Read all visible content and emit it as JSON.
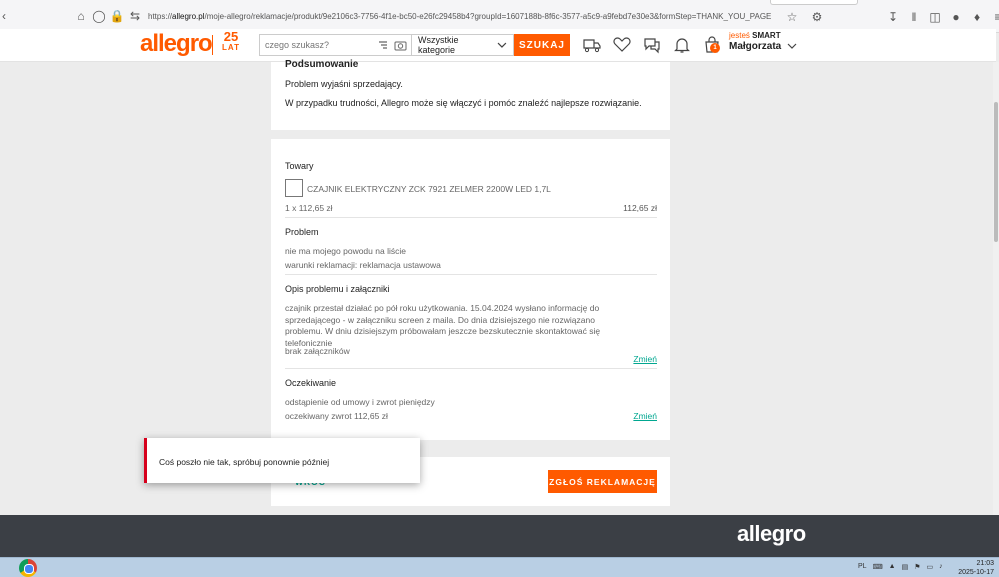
{
  "browser": {
    "url_prefix": "https://",
    "url_domain": "allegro.pl",
    "url_path": "/moje-allegro/reklamacje/produkt/9e2106c3-7756-4f1e-bc50-e26fc29458b4?groupId=1607188b-8f6c-3577-a5c9-a9febd7e30e3&formStep=THANK_YOU_PAGE"
  },
  "header": {
    "logo": "allegro",
    "logo_25": "25",
    "logo_lat": "LAT",
    "search_placeholder": "czego szukasz?",
    "category": "Wszystkie kategorie",
    "search_button": "SZUKAJ",
    "smart_prefix": "jesteś",
    "smart_label": "SMART",
    "user_name": "Małgorzata",
    "cart_count": "1"
  },
  "summary": {
    "title": "Podsumowanie",
    "line1": "Problem wyjaśni sprzedający.",
    "line2": "W przypadku trudności, Allegro może się włączyć i pomóc znaleźć najlepsze rozwiązanie."
  },
  "details": {
    "goods_label": "Towary",
    "product_name": "CZAJNIK ELEKTRYCZNY ZCK 7921 ZELMER 2200W LED 1,7L",
    "quantity_price": "1 x 112,65 zł",
    "total": "112,65 zł",
    "problem_label": "Problem",
    "problem_reason": "nie ma mojego powodu na liście",
    "problem_terms": "warunki reklamacji: reklamacja ustawowa",
    "description_label": "Opis problemu i załączniki",
    "description_text": "czajnik przestał działać po pół roku użytkowania. 15.04.2024 wysłano informację do sprzedającego - w załączniku screen z maila. Do dnia dzisiejszego nie rozwiązano problemu. W dniu dzisiejszym próbowałam jeszcze bezskutecznie skontaktować się telefonicznie",
    "attachments": "brak załączników",
    "change_link": "Zmień",
    "expectation_label": "Oczekiwanie",
    "expectation_text": "odstąpienie od umowy i zwrot pieniędzy",
    "expected_refund": "oczekiwany zwrot 112,65 zł",
    "change_link2": "Zmień"
  },
  "actions": {
    "back": "WRÓĆ",
    "submit": "ZGŁOŚ REKLAMACJĘ"
  },
  "toast": {
    "message": "Coś poszło nie tak, spróbuj ponownie później"
  },
  "footer": {
    "logo": "allegro"
  },
  "taskbar": {
    "lang": "PL",
    "time": "21:03",
    "date": "2025-10-17"
  },
  "colors": {
    "brand": "#ff5a00",
    "link": "#00a790",
    "error": "#d6001c",
    "footer": "#3b3f45"
  }
}
